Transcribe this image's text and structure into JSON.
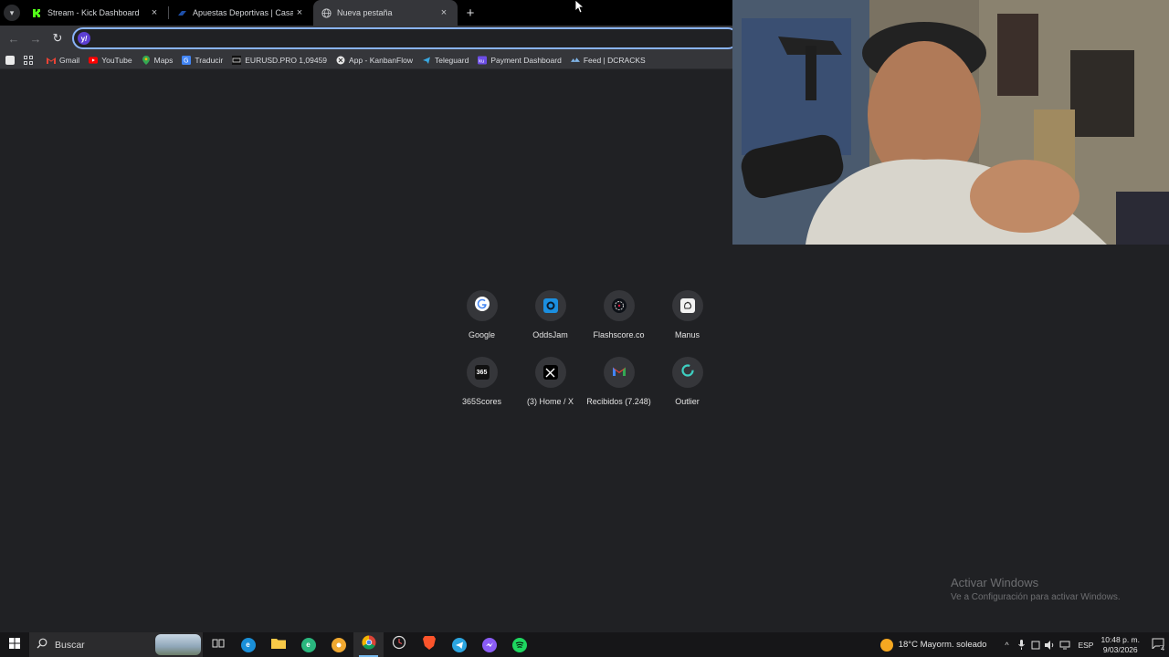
{
  "tabs": [
    {
      "title": "Stream - Kick Dashboard",
      "favicon": "kick-icon",
      "active": false
    },
    {
      "title": "Apuestas Deportivas | Casa de A",
      "favicon": "betting-site-icon",
      "active": false
    },
    {
      "title": "Nueva pestaña",
      "favicon": "globe-icon",
      "active": true
    }
  ],
  "omnibox": {
    "value": "",
    "placeholder": ""
  },
  "bookmarks": [
    {
      "label": "Gmail",
      "icon": "gmail-icon"
    },
    {
      "label": "YouTube",
      "icon": "youtube-icon"
    },
    {
      "label": "Maps",
      "icon": "maps-icon"
    },
    {
      "label": "Traducir",
      "icon": "translate-icon"
    },
    {
      "label": "EURUSD.PRO 1,09459",
      "icon": "chart-icon"
    },
    {
      "label": "App - KanbanFlow",
      "icon": "kanbanflow-icon"
    },
    {
      "label": "Teleguard",
      "icon": "teleguard-icon"
    },
    {
      "label": "Payment Dashboard",
      "icon": "ku-icon"
    },
    {
      "label": "Feed | DCRACKS",
      "icon": "dcracks-icon"
    }
  ],
  "shortcuts": [
    {
      "label": "Google",
      "icon": "google-icon"
    },
    {
      "label": "OddsJam",
      "icon": "oddsjam-icon"
    },
    {
      "label": "Flashscore.co",
      "icon": "flashscore-icon"
    },
    {
      "label": "Manus",
      "icon": "manus-icon"
    },
    {
      "label": "365Scores",
      "icon": "365scores-icon",
      "icon_text": "365"
    },
    {
      "label": "(3) Home / X",
      "icon": "x-icon"
    },
    {
      "label": "Recibidos (7.248)",
      "icon": "gmail-icon"
    },
    {
      "label": "Outlier",
      "icon": "outlier-icon"
    }
  ],
  "watermark": {
    "title": "Activar Windows",
    "subtitle": "Ve a Configuración para activar Windows."
  },
  "taskbar": {
    "search_label": "Buscar",
    "weather": "18°C  Mayorm. soleado",
    "language": "ESP",
    "time": "10:48 p. m.",
    "date": "9/03/2026",
    "notification_count": "4"
  },
  "colors": {
    "accent": "#8ab4f8",
    "page_bg": "#202124",
    "toolbar_bg": "#35363a"
  }
}
